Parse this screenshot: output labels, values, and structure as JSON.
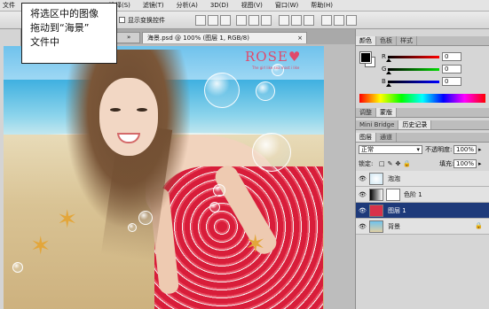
{
  "menubar": [
    "文件",
    "选择(S)",
    "滤镜(T)",
    "分析(A)",
    "3D(D)",
    "视图(V)",
    "窗口(W)",
    "帮助(H)"
  ],
  "options_bar": {
    "transform_label": "显示变换控件"
  },
  "document": {
    "inactive_tab": "»",
    "active_tab": "海景.psd @ 100% (图层 1, RGB/8)",
    "active_tab_close": "×"
  },
  "canvas": {
    "brand": "ROSE♥",
    "tagline": "The girl like sea most i like"
  },
  "callout": {
    "line1": "将选区中的图像",
    "line2": "拖动到“海景”",
    "line3": "文件中"
  },
  "color_panel": {
    "tabs": [
      "颜色",
      "色板",
      "样式"
    ],
    "foreground": "#000000",
    "background": "#ffffff",
    "channels": [
      {
        "label": "R",
        "value": "0"
      },
      {
        "label": "G",
        "value": "0"
      },
      {
        "label": "B",
        "value": "0"
      }
    ]
  },
  "adjust_tabs": [
    "调整",
    "蒙版"
  ],
  "bridge_tabs": [
    "Mini Bridge",
    "历史记录"
  ],
  "layers_panel": {
    "tabs": [
      "图层",
      "通道"
    ],
    "blend_mode": "正常",
    "opacity_label": "不透明度:",
    "opacity": "100%",
    "lock_label": "锁定:",
    "fill_label": "填充:",
    "fill": "100%",
    "layers": [
      {
        "name": "泡泡",
        "selected": false
      },
      {
        "name": "色阶 1",
        "selected": false
      },
      {
        "name": "图层 1",
        "selected": true
      },
      {
        "name": "背景",
        "selected": false
      }
    ]
  }
}
